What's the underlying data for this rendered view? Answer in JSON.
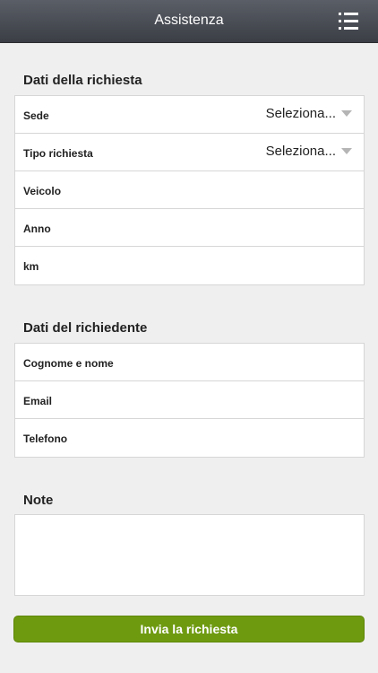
{
  "header": {
    "title": "Assistenza",
    "menu_icon": "list-menu-icon"
  },
  "request_section": {
    "title": "Dati della richiesta",
    "fields": [
      {
        "label": "Sede",
        "value": "Seleziona..."
      },
      {
        "label": "Tipo richiesta",
        "value": "Seleziona..."
      },
      {
        "label": "Veicolo",
        "value": ""
      },
      {
        "label": "Anno",
        "value": ""
      },
      {
        "label": "km",
        "value": ""
      }
    ]
  },
  "requester_section": {
    "title": "Dati del richiedente",
    "fields": [
      {
        "label": "Cognome e nome",
        "value": ""
      },
      {
        "label": "Email",
        "value": ""
      },
      {
        "label": "Telefono",
        "value": ""
      }
    ]
  },
  "notes_section": {
    "title": "Note",
    "value": ""
  },
  "submit": {
    "label": "Invia la richiesta"
  },
  "colors": {
    "navbar": "#3b3e45",
    "submit": "#6e9a10",
    "background": "#efefef"
  }
}
